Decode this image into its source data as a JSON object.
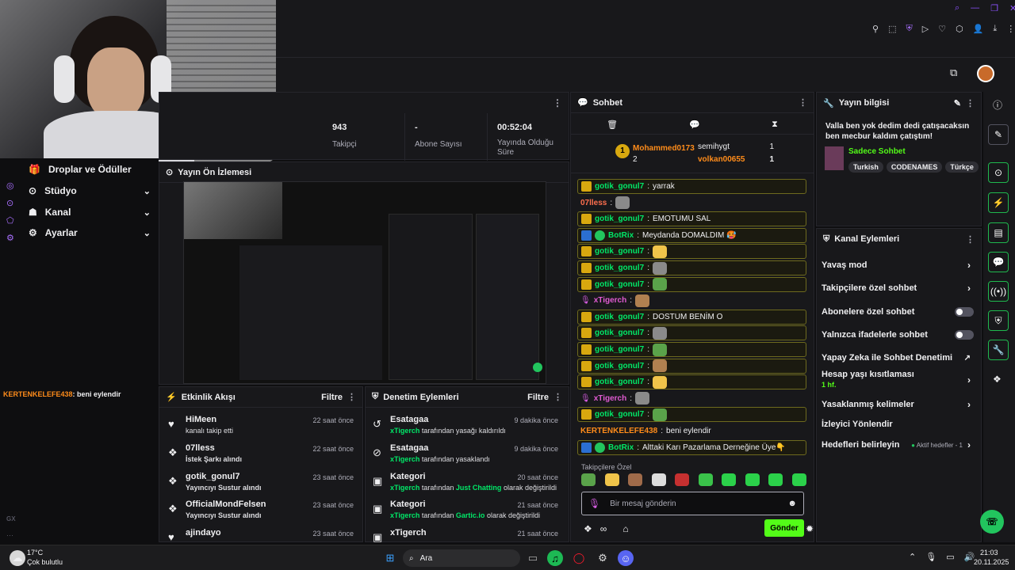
{
  "stats": [
    {
      "value": "943",
      "label": "Takipçi"
    },
    {
      "value": "-",
      "label": "Abone Sayısı"
    },
    {
      "value": "00:52:04",
      "label": "Yayında Olduğu Süre"
    }
  ],
  "sidebar": {
    "items": [
      {
        "label": "Droplar ve Ödüller"
      },
      {
        "label": "Stüdyo"
      },
      {
        "label": "Kanal"
      },
      {
        "label": "Ayarlar"
      }
    ],
    "gx_label": "GX"
  },
  "overlay_chat": {
    "user": "KERTENKELEFE438",
    "text": ": beni eylendir"
  },
  "preview": {
    "title": "Yayın Ön İzlemesi"
  },
  "activity": {
    "title": "Etkinlik Akışı",
    "filter": "Filtre",
    "items": [
      {
        "name": "HiMeen",
        "sub": "kanalı takip etti",
        "time": "22 saat önce",
        "icon": "heart-icon"
      },
      {
        "name": "07lless",
        "sub": "İstek Şarkı alındı",
        "time": "22 saat önce",
        "icon": "channel-points-icon"
      },
      {
        "name": "gotik_gonul7",
        "sub": "Yayıncıyı Sustur alındı",
        "time": "23 saat önce",
        "icon": "channel-points-icon"
      },
      {
        "name": "OfficialMondFelsen",
        "sub": "Yayıncıyı Sustur alındı",
        "time": "23 saat önce",
        "icon": "channel-points-icon"
      },
      {
        "name": "ajindayo",
        "sub": "",
        "time": "23 saat önce",
        "icon": "heart-icon"
      }
    ]
  },
  "moderation": {
    "title": "Denetim Eylemleri",
    "filter": "Filtre",
    "items": [
      {
        "name": "Esatagaa",
        "user": "xTigerch",
        "mid": "tarafından yasağı kaldırıldı",
        "game": "",
        "end": "",
        "time": "9 dakika önce",
        "icon": "unban-icon"
      },
      {
        "name": "Esatagaa",
        "user": "xTigerch",
        "mid": "tarafından yasaklandı",
        "game": "",
        "end": "",
        "time": "9 dakika önce",
        "icon": "ban-icon"
      },
      {
        "name": "Kategori",
        "user": "xTigerch",
        "mid": "tarafından",
        "game": "Just Chatting",
        "end": "olarak değiştirildi",
        "time": "20 saat önce",
        "icon": "category-icon"
      },
      {
        "name": "Kategori",
        "user": "xTigerch",
        "mid": "tarafından",
        "game": "Gartic.io",
        "end": "olarak değiştirildi",
        "time": "21 saat önce",
        "icon": "category-icon"
      },
      {
        "name": "xTigerch",
        "user": "",
        "mid": "",
        "game": "",
        "end": "",
        "time": "21 saat önce",
        "icon": "category-icon"
      }
    ]
  },
  "chat": {
    "title": "Sohbet",
    "leaderboard": {
      "first": {
        "rank": "1",
        "name": "Mohammed0173",
        "count": "2"
      },
      "others": [
        {
          "name": "semihygt",
          "count": "1"
        },
        {
          "name": "volkan00655",
          "count": "1"
        }
      ]
    },
    "messages": [
      {
        "user": "gotik_gonul7",
        "text": "yarrak",
        "color": "green",
        "badge": "yellow",
        "hl": true,
        "emote": false
      },
      {
        "user": "07lless",
        "text": "",
        "color": "red",
        "badge": "",
        "hl": false,
        "emote": true
      },
      {
        "user": "gotik_gonul7",
        "text": "EMOTUMU SAL",
        "color": "green",
        "badge": "yellow",
        "hl": true,
        "emote": false
      },
      {
        "user": "BotRix",
        "text": "Meydanda DOMALDIM 🥵",
        "color": "green",
        "badge": "blue",
        "hl": true,
        "emote": false
      },
      {
        "user": "gotik_gonul7",
        "text": "",
        "color": "green",
        "badge": "yellow",
        "hl": true,
        "emote": true
      },
      {
        "user": "gotik_gonul7",
        "text": "",
        "color": "green",
        "badge": "yellow",
        "hl": true,
        "emote": true
      },
      {
        "user": "gotik_gonul7",
        "text": "",
        "color": "green",
        "badge": "yellow",
        "hl": true,
        "emote": true
      },
      {
        "user": "xTigerch",
        "text": "",
        "color": "pink",
        "badge": "",
        "hl": false,
        "emote": true
      },
      {
        "user": "gotik_gonul7",
        "text": "DOSTUM BENİM O",
        "color": "green",
        "badge": "yellow",
        "hl": true,
        "emote": false
      },
      {
        "user": "gotik_gonul7",
        "text": "",
        "color": "green",
        "badge": "yellow",
        "hl": true,
        "emote": true
      },
      {
        "user": "gotik_gonul7",
        "text": "",
        "color": "green",
        "badge": "yellow",
        "hl": true,
        "emote": true
      },
      {
        "user": "gotik_gonul7",
        "text": "",
        "color": "green",
        "badge": "yellow",
        "hl": true,
        "emote": true
      },
      {
        "user": "gotik_gonul7",
        "text": "",
        "color": "green",
        "badge": "yellow",
        "hl": true,
        "emote": true
      },
      {
        "user": "xTigerch",
        "text": "",
        "color": "pink",
        "badge": "",
        "hl": false,
        "emote": true
      },
      {
        "user": "gotik_gonul7",
        "text": "",
        "color": "green",
        "badge": "yellow",
        "hl": true,
        "emote": true
      },
      {
        "user": "KERTENKELEFE438",
        "text": "beni eylendir",
        "color": "orange",
        "badge": "",
        "hl": false,
        "emote": false
      },
      {
        "user": "BotRix",
        "text": "Alttaki Karı Pazarlama Derneğine Üye👇",
        "color": "green",
        "badge": "blue",
        "hl": true,
        "emote": false
      }
    ],
    "emote_section": "Takipçilere Özel",
    "input_placeholder": "Bir mesaj gönderin",
    "send": "Gönder"
  },
  "stream_info": {
    "title": "Yayın bilgisi",
    "stream_title": "Valla ben yok dedim dedi çatışacaksın ben mecbur kaldım çatıştım!",
    "category": "Sadece Sohbet",
    "tags": [
      "Turkish",
      "CODENAMES",
      "Türkçe"
    ]
  },
  "channel_actions": {
    "title": "Kanal Eylemleri",
    "items": [
      {
        "label": "Yavaş mod",
        "control": "chevron"
      },
      {
        "label": "Takipçilere özel sohbet",
        "control": "chevron"
      },
      {
        "label": "Abonelere özel sohbet",
        "control": "toggle"
      },
      {
        "label": "Yalnızca ifadelerle sohbet",
        "control": "toggle"
      },
      {
        "label": "Yapay Zeka ile Sohbet Denetimi",
        "control": "external"
      },
      {
        "label": "Hesap yaşı kısıtlaması",
        "control": "chevron",
        "sub": "1 hf."
      },
      {
        "label": "Yasaklanmış kelimeler",
        "control": "chevron"
      },
      {
        "label": "İzleyici Yönlendir",
        "control": "none"
      },
      {
        "label": "Hedefleri belirleyin",
        "control": "chevron",
        "extra": "Aktif hedefler - 1"
      }
    ]
  },
  "taskbar": {
    "weather_temp": "17°C",
    "weather_desc": "Çok bulutlu",
    "search": "Ara",
    "time": "21:03",
    "date": "20.11.2025"
  },
  "colors": {
    "accent_green": "#53fc18",
    "bg": "#0e0e10",
    "panel": "#18181b"
  }
}
